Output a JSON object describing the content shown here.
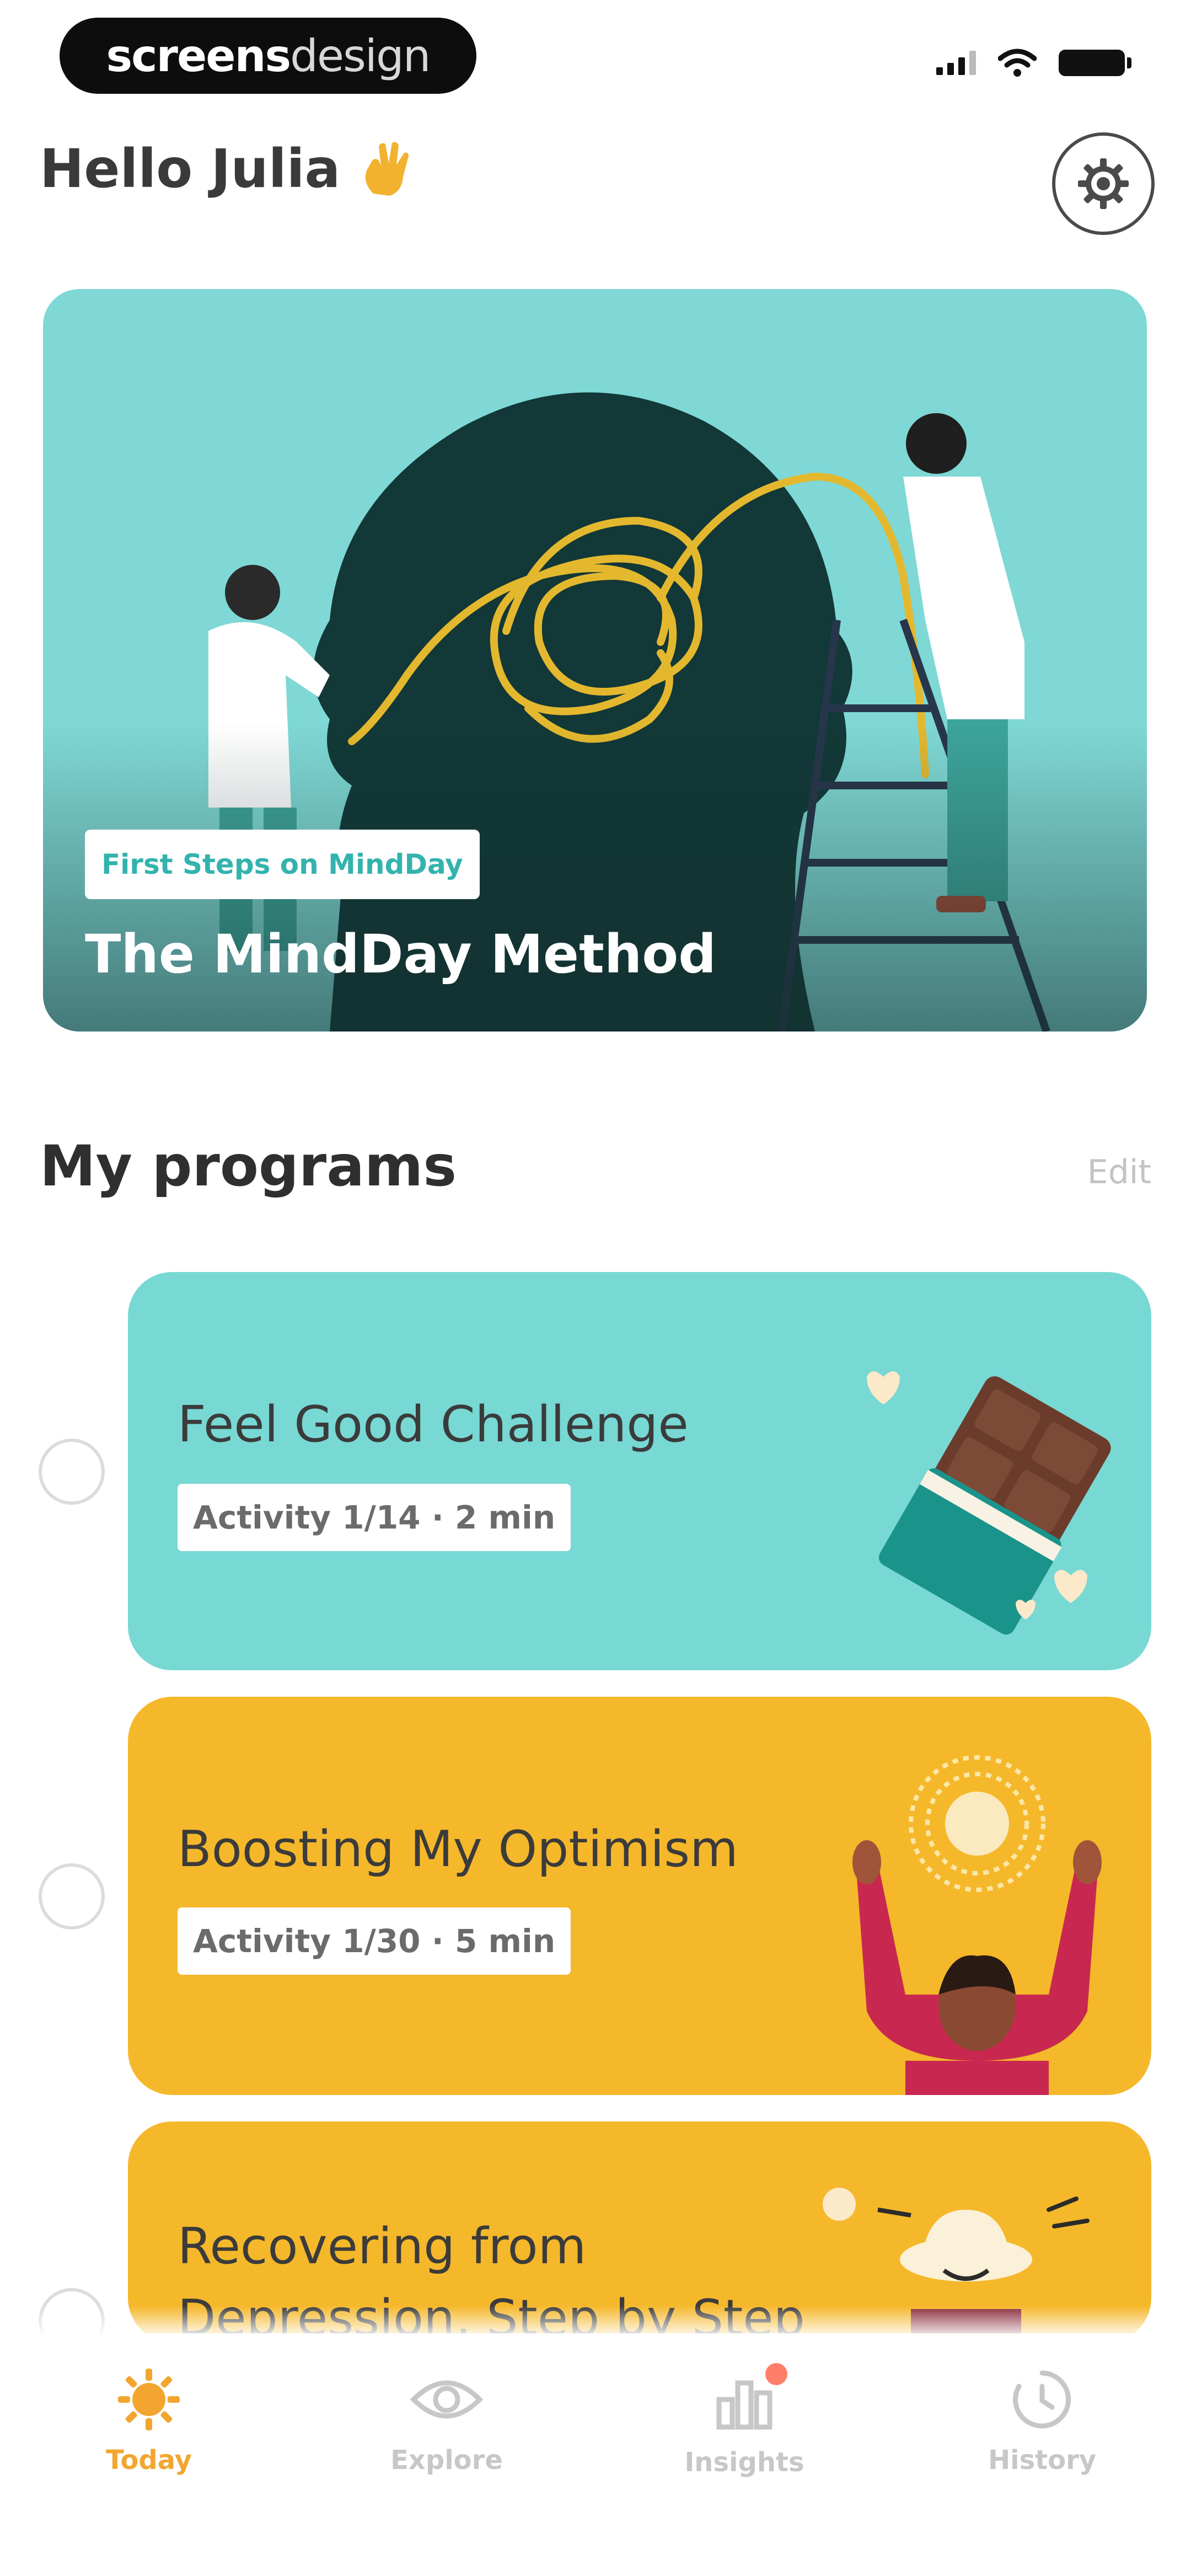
{
  "status_bar": {
    "brand_bold": "screens",
    "brand_light": "design"
  },
  "header": {
    "greeting": "Hello Julia",
    "wave_icon": "hand-wave-icon",
    "settings_icon": "gear-icon"
  },
  "hero": {
    "tag": "First Steps on MindDay",
    "title": "The MindDay Method"
  },
  "programs_section": {
    "title": "My programs",
    "edit_label": "Edit",
    "items": [
      {
        "title": "Feel Good Challenge",
        "badge": "Activity 1/14 · 2 min",
        "color": "#78d8d4",
        "illustration": "chocolate-bar-icon"
      },
      {
        "title": "Boosting My Optimism",
        "badge": "Activity 1/30 · 5 min",
        "color": "#f5b82a",
        "illustration": "person-with-sun-icon"
      },
      {
        "title": "Recovering from Depression, Step by Step",
        "badge": "",
        "color": "#f5b82a",
        "illustration": "person-with-hat-icon"
      }
    ]
  },
  "tab_bar": {
    "tabs": [
      {
        "label": "Today",
        "icon": "sun-icon",
        "active": true
      },
      {
        "label": "Explore",
        "icon": "eye-icon",
        "active": false
      },
      {
        "label": "Insights",
        "icon": "bar-chart-icon",
        "active": false
      },
      {
        "label": "History",
        "icon": "clock-icon",
        "active": false
      }
    ]
  },
  "colors": {
    "accent": "#f2a630",
    "teal": "#78d8d4",
    "yellow": "#f5b82a"
  }
}
